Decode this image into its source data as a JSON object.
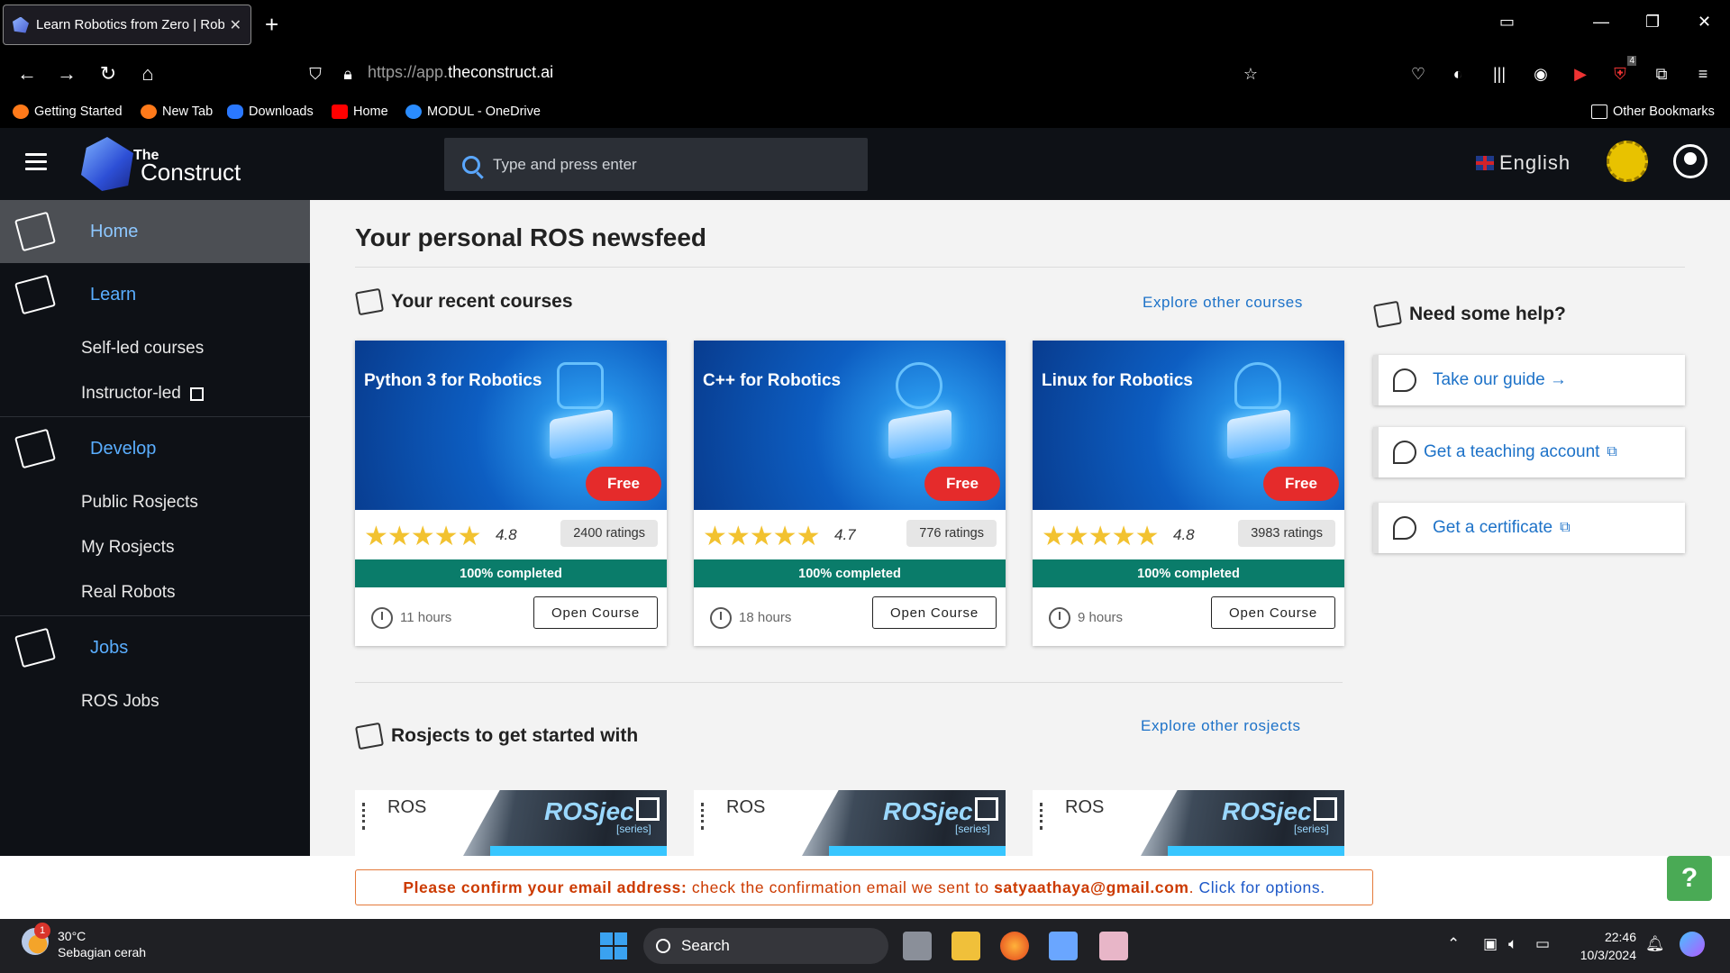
{
  "browser": {
    "tab_title": "Learn Robotics from Zero | Rob",
    "url_prefix": "https://app.",
    "url_domain": "theconstruct.ai",
    "bookmarks": [
      "Getting Started",
      "New Tab",
      "Downloads",
      "Home",
      "MODUL - OneDrive"
    ],
    "other_bookmarks": "Other Bookmarks",
    "notification_count": "4"
  },
  "header": {
    "brand_top": "The",
    "brand_bottom": "Construct",
    "search_placeholder": "Type and press enter",
    "language": "English"
  },
  "sidebar": {
    "home": "Home",
    "learn": "Learn",
    "learn_items": [
      "Self-led courses",
      "Instructor-led"
    ],
    "develop": "Develop",
    "develop_items": [
      "Public Rosjects",
      "My Rosjects",
      "Real Robots"
    ],
    "jobs": "Jobs",
    "jobs_items": [
      "ROS Jobs"
    ]
  },
  "main": {
    "title": "Your personal ROS newsfeed",
    "recent_courses_title": "Your recent courses",
    "explore_courses": "Explore other courses",
    "courses": [
      {
        "title": "Python 3 for Robotics",
        "badge": "Free",
        "stars": "★★★★★",
        "rating": "4.8",
        "ratings": "2400 ratings",
        "progress": "100% completed",
        "hours": "11 hours",
        "button": "Open Course"
      },
      {
        "title": "C++ for Robotics",
        "badge": "Free",
        "stars": "★★★★★",
        "rating": "4.7",
        "ratings": "776 ratings",
        "progress": "100% completed",
        "hours": "18 hours",
        "button": "Open Course"
      },
      {
        "title": "Linux for Robotics",
        "badge": "Free",
        "stars": "★★★★★",
        "rating": "4.8",
        "ratings": "3983 ratings",
        "progress": "100% completed",
        "hours": "9 hours",
        "button": "Open Course"
      }
    ],
    "rosjects_title": "Rosjects to get started with",
    "explore_rosjects": "Explore other rosjects",
    "rosject_cards": [
      {
        "ros_label": "ROS",
        "brand": "ROSjec",
        "series": "[series]"
      },
      {
        "ros_label": "ROS",
        "brand": "ROSjec",
        "series": "[series]"
      },
      {
        "ros_label": "ROS",
        "brand": "ROSjec",
        "series": "[series]"
      }
    ],
    "help_title": "Need some help?",
    "help_items": [
      "Take our guide →",
      "Get a teaching account",
      "Get a certificate"
    ]
  },
  "banner": {
    "warning": "Please confirm your email address:",
    "message": " check the confirmation email we sent to ",
    "email": "satyaathaya@gmail.com",
    "period": ". ",
    "link": "Click for options.",
    "help_button": "?"
  },
  "taskbar": {
    "temperature": "30°C",
    "weather": "Sebagian cerah",
    "weather_badge": "1",
    "search": "Search",
    "time": "22:46",
    "date": "10/3/2024"
  },
  "colors": {
    "accent_blue": "#1d72c8",
    "progress_green": "#0a7c6a",
    "free_red": "#e52b2b",
    "banner_orange": "#cc3a00"
  }
}
